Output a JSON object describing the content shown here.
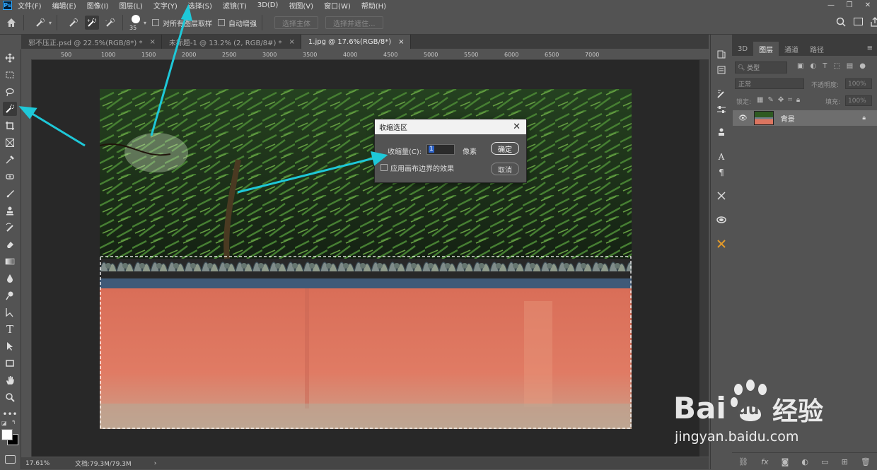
{
  "menubar": {
    "logo": "Ps",
    "items": [
      "文件(F)",
      "编辑(E)",
      "图像(I)",
      "图层(L)",
      "文字(Y)",
      "选择(S)",
      "滤镜(T)",
      "3D(D)",
      "视图(V)",
      "窗口(W)",
      "帮助(H)"
    ]
  },
  "options": {
    "brush_size": "35",
    "sample_all_layers": "对所有图层取样",
    "auto_enhance": "自动增强",
    "select_subject": "选择主体",
    "select_and_mask": "选择并遮住..."
  },
  "tabs": [
    {
      "label": "邪不压正.psd @ 22.5%(RGB/8*) *",
      "close": "×"
    },
    {
      "label": "未标题-1 @ 13.2% (2, RGB/8#) *",
      "close": "×"
    },
    {
      "label": "1.jpg @ 17.6%(RGB/8*)",
      "close": "×"
    }
  ],
  "ruler": {
    "ticks": [
      "500",
      "1000",
      "1500",
      "2000",
      "2500",
      "3000",
      "3500",
      "4000",
      "4500",
      "5000",
      "5500",
      "6000",
      "6500",
      "7000"
    ]
  },
  "dialog": {
    "title": "收缩选区",
    "contract_label": "收缩量(C):",
    "contract_value": "1",
    "unit": "像素",
    "ok": "确定",
    "cancel": "取消",
    "apply_canvas_bounds": "应用画布边界的效果"
  },
  "status": {
    "zoom": "17.61%",
    "doc": "文档:79.3M/79.3M"
  },
  "layers_panel": {
    "tabs": [
      "3D",
      "图层",
      "通道",
      "路径"
    ],
    "filter_placeholder": "类型",
    "blend_mode": "正常",
    "opacity_label": "不透明度:",
    "opacity_value": "100%",
    "lock_label": "锁定:",
    "fill_label": "填充:",
    "fill_value": "100%",
    "layer_name": "背景"
  },
  "watermark": {
    "brand": "Bai",
    "brand2": "du",
    "suffix": "经验",
    "url": "jingyan.baidu.com"
  },
  "colors": {
    "annotation_arrow": "#1ec8d8",
    "wall": "#dd7560",
    "ui_bg": "#535353"
  }
}
